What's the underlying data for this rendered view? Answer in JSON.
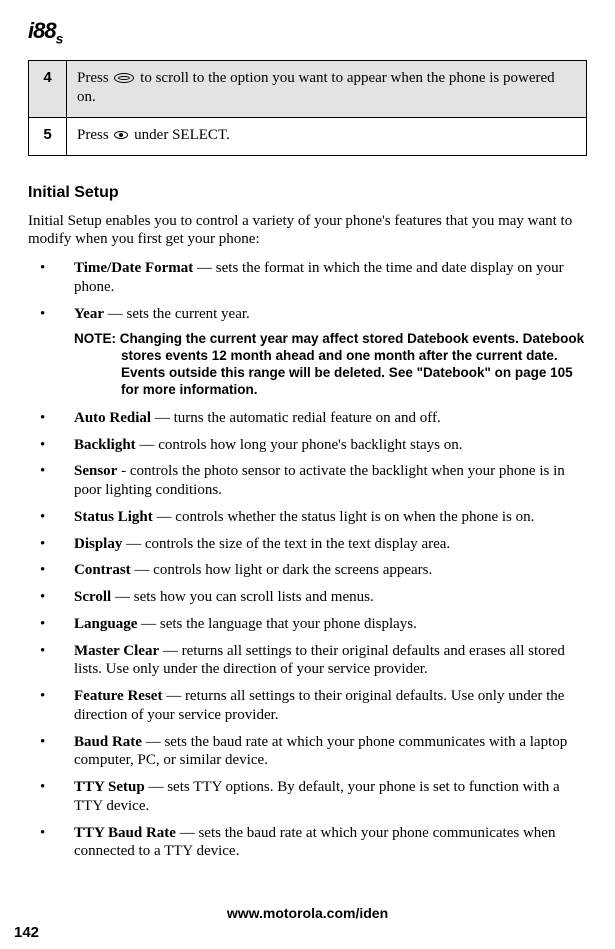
{
  "logo": "i88s",
  "steps": [
    {
      "num": "4",
      "pre": "Press ",
      "post": " to scroll to the option you want to appear when the phone is powered on.",
      "icon": "oval"
    },
    {
      "num": "5",
      "pre": "Press ",
      "post": " under SELECT.",
      "icon": "dot"
    }
  ],
  "section_heading": "Initial Setup",
  "intro": "Initial Setup enables you to control a variety of your phone's features that you may want to modify when you first get your phone:",
  "features": [
    {
      "name": "Time/Date Format",
      "desc": " — sets the format in which the time and date display on your phone."
    },
    {
      "name": "Year",
      "desc": " — sets the current year."
    },
    {
      "name": "Auto Redial",
      "desc": " — turns the automatic redial feature on and off."
    },
    {
      "name": "Backlight",
      "desc": " — controls how long your phone's backlight stays on."
    },
    {
      "name": "Sensor",
      "desc": " - controls the photo sensor to activate the backlight when your phone is in poor lighting conditions."
    },
    {
      "name": "Status Light",
      "desc": " — controls whether the status light is on when the phone is on."
    },
    {
      "name": "Display",
      "desc": " — controls the size of the text in the text display area."
    },
    {
      "name": "Contrast",
      "desc": " — controls how light or dark the screens appears."
    },
    {
      "name": "Scroll",
      "desc": " — sets how you can scroll lists and menus."
    },
    {
      "name": "Language",
      "desc": " — sets the language that your phone displays."
    },
    {
      "name": "Master Clear",
      "desc": " — returns all settings to their original defaults and erases all stored lists. Use only under the direction of your service provider."
    },
    {
      "name": "Feature Reset",
      "desc": " — returns all settings to their original defaults. Use only under the direction of your service provider."
    },
    {
      "name": "Baud Rate",
      "desc": " — sets the baud rate at which your phone communicates with a laptop computer, PC, or similar device."
    },
    {
      "name": "TTY Setup",
      "desc": " — sets TTY options. By default, your phone is set to function with a TTY device."
    },
    {
      "name": "TTY Baud Rate",
      "desc": " — sets the baud rate at which your phone communicates when connected to a TTY device."
    }
  ],
  "note_label": "NOTE: ",
  "note_text": "Changing the current year may affect stored Datebook events. Datebook stores events 12 month ahead and one month after the current date. Events outside this range will be deleted. See \"Datebook\" on page 105 for more information.",
  "footer_url": "www.motorola.com/iden",
  "page_number": "142"
}
